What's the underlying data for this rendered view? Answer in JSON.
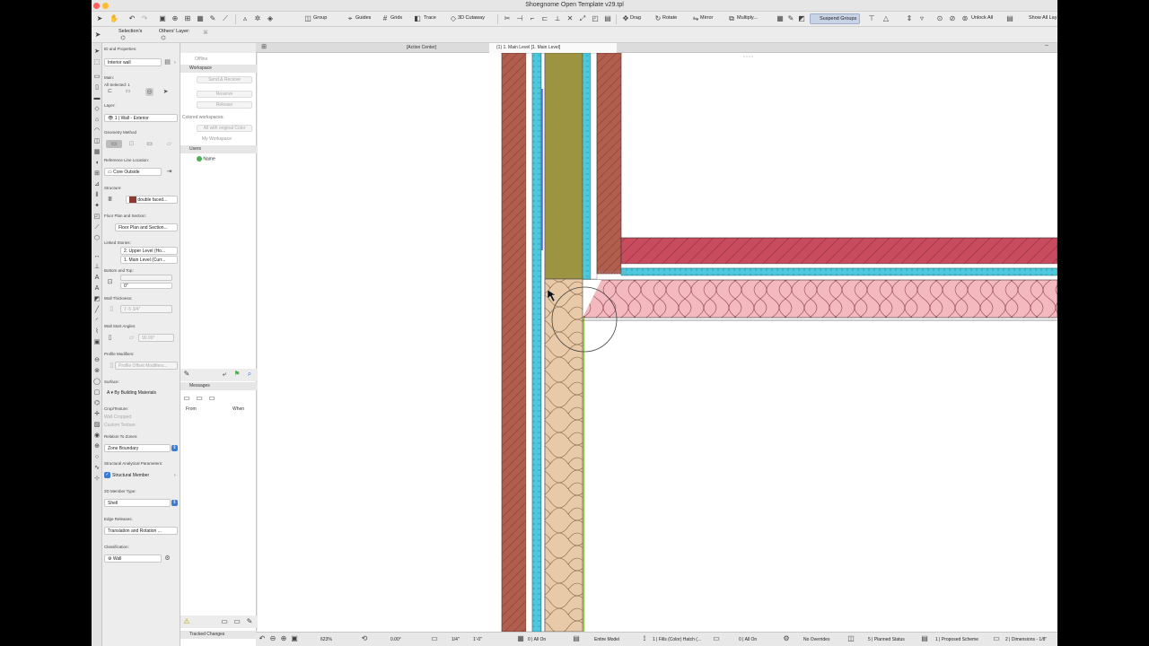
{
  "window": {
    "title": "Shoegnome Open Template v29.tpl",
    "colors": {
      "close": "#ff5f57",
      "minimize": "#febc2e",
      "zoom": "#28c840"
    }
  },
  "toolbar": {
    "group": "Group",
    "guides": "Guides",
    "grids": "Grids",
    "trace": "Trace",
    "cutaway": "3D Cutaway",
    "drag": "Drag",
    "rotate": "Rotate",
    "mirror": "Mirror",
    "multiply": "Multiply...",
    "suspend_groups": "Suspend Groups",
    "unlock_all": "Unlock All",
    "show_all_layers": "Show All Lay"
  },
  "infobox": {
    "selections": "Selection's",
    "others_layer": "Others' Layer:"
  },
  "tabs": {
    "action_center": "[Action Center]",
    "floor_plan": "(1) 1. Main Level [1. Main Level]"
  },
  "settings": {
    "id_props": "ID and Properties:",
    "id_value": "Interior wall",
    "main": "Main:",
    "all_selected": "All Selected: 1",
    "layer_label": "Layer:",
    "layer_value": "1 | Wall - Exterior",
    "geometry": "Geometry Method",
    "ref_line": "Reference Line Location:",
    "ref_value": "Core Outside",
    "structure": "Structure:",
    "structure_value": "double faced...",
    "floor_plan_section": "Floor Plan and Section:",
    "fps_value": "Floor Plan and Section...",
    "linked_stories": "Linked Stories:",
    "upper_level": "2. Upper Level (Ho...",
    "main_level": "1. Main Level (Curr...",
    "bottom_top": "Bottom and Top:",
    "offset_value": "0\"",
    "wall_thickness": "Wall Thickness:",
    "thickness_value": "1'-5 3/4\"",
    "wall_start_angles": "Wall Start Angles:",
    "angle_value": "90.00°",
    "profile_modifiers": "Profile Modifiers:",
    "profile_value": "Profile Offset Modifiers...",
    "surface": "Surface:",
    "surface_value": "By Building Materials",
    "crop_texture": "Crop/Texture:",
    "wall_cropped": "Wall Cropped",
    "custom_texture": "Custom Texture",
    "relation_zones": "Relation To Zones:",
    "zone_value": "Zone Boundary",
    "structural_params": "Structural Analytical Parameters:",
    "structural_member": "Structural Member",
    "member_type": "2D Member Type:",
    "member_type_value": "Shell",
    "edge_releases": "Edge Releases:",
    "edge_value": "Translation and Rotation ...",
    "classification": "Classification:",
    "class_value": "Wall"
  },
  "workspace": {
    "offline": "Offline",
    "workspace": "Workspace",
    "send_receive": "Send & Receive",
    "reserve": "Reserve",
    "release": "Release",
    "colored_workspaces": "Colored workspaces:",
    "all_original": "All with original Color",
    "my_workspace": "My Workspace",
    "users": "Users",
    "name": "Name",
    "messages": "Messages",
    "from": "From",
    "when": "When",
    "tracked_changes": "Tracked Changes"
  },
  "statusbar": {
    "zoom": "623%",
    "angle": "0.00°",
    "scale": "1/4\"",
    "scale_unit": "1'-0\"",
    "layers": "0 | All On",
    "model": "Entire Model",
    "fills": "1 | Fills (Color) Hatch (...",
    "layers2": "0 | All On",
    "overrides": "No Overrides",
    "planned": "5 | Planned Status",
    "scheme": "1 | Proposed Scheme",
    "dimensions": "2 | Dimensions - 1/8\""
  },
  "colors": {
    "brick": "#b05e4e",
    "sheathing": "#4ec8dc",
    "stud": "#9c9440",
    "insulation_beige": "#e8c9a8",
    "insulation_pink": "#f4b8bf",
    "slab_red": "#c84b5e",
    "accent_blue": "#3a7bd5"
  }
}
